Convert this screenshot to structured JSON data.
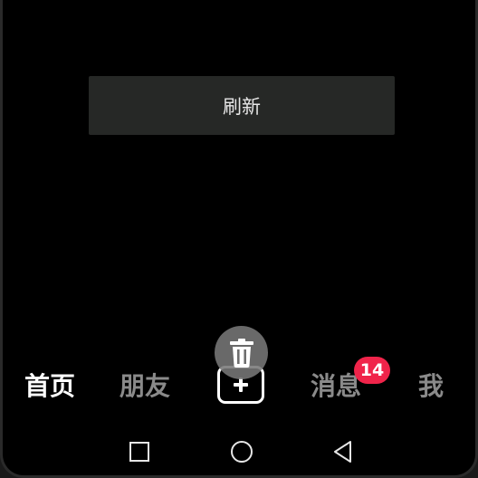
{
  "main": {
    "refresh_label": "刷新"
  },
  "tabbar": {
    "tabs": [
      {
        "label": "首页",
        "active": true
      },
      {
        "label": "朋友",
        "active": false
      },
      {
        "label": "消息",
        "active": false
      },
      {
        "label": "我",
        "active": false
      }
    ],
    "create_icon": "plus-icon",
    "messages_badge": "14"
  },
  "overlay": {
    "delete_icon": "trash-icon"
  },
  "system_nav": {
    "icons": [
      "square-recent-apps-icon",
      "circle-home-icon",
      "triangle-back-icon"
    ]
  },
  "colors": {
    "background": "#000000",
    "button_bg": "#262826",
    "active_tab": "#ffffff",
    "inactive_tab": "#8a8a8a",
    "badge": "#f0244a"
  }
}
